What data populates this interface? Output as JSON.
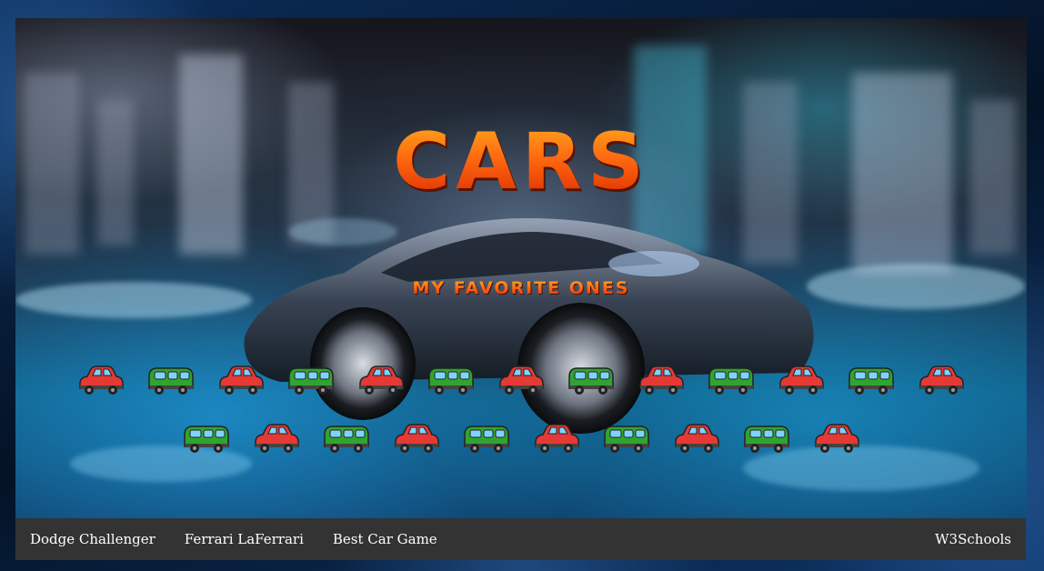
{
  "header": {
    "title": "CARS",
    "subtitle": "My Favorite Ones"
  },
  "car_rows": [
    {
      "cars": [
        "red",
        "green",
        "red",
        "green",
        "red",
        "green",
        "red",
        "green",
        "red",
        "green",
        "red",
        "green",
        "red"
      ]
    },
    {
      "cars": [
        "green",
        "red",
        "green",
        "red",
        "green",
        "red",
        "green",
        "red",
        "green",
        "red"
      ]
    }
  ],
  "nav": {
    "links": [
      {
        "label": "Dodge Challenger"
      },
      {
        "label": "Ferrari LaFerrari"
      },
      {
        "label": "Best Car Game"
      }
    ],
    "right_link": {
      "label": "W3Schools"
    }
  },
  "colors": {
    "title_orange": "#ff6a10",
    "navbar_bg": "#333333",
    "nav_text": "#ffffff",
    "car_red": "#e53935",
    "car_green": "#2fa52f"
  }
}
